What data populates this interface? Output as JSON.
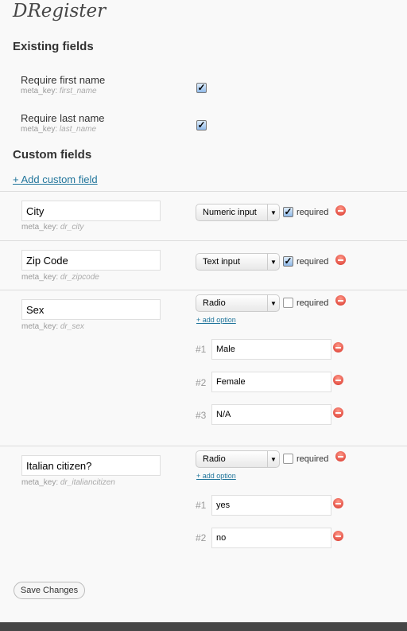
{
  "title": "DRegister",
  "existing": {
    "heading": "Existing fields",
    "items": [
      {
        "label": "Require first name",
        "meta_prefix": "meta_key:",
        "meta_key": "first_name",
        "checked": true
      },
      {
        "label": "Require last name",
        "meta_prefix": "meta_key:",
        "meta_key": "last_name",
        "checked": true
      }
    ]
  },
  "custom": {
    "heading": "Custom fields",
    "add_link": "+ Add custom field",
    "required_label": "required",
    "add_option": "+ add option",
    "meta_prefix": "meta_key:",
    "fields": [
      {
        "name": "City",
        "meta_key": "dr_city",
        "type": "Numeric input",
        "required": true
      },
      {
        "name": "Zip Code",
        "meta_key": "dr_zipcode",
        "type": "Text input",
        "required": true
      },
      {
        "name": "Sex",
        "meta_key": "dr_sex",
        "type": "Radio",
        "required": false,
        "options": [
          {
            "num": "#1",
            "value": "Male"
          },
          {
            "num": "#2",
            "value": "Female"
          },
          {
            "num": "#3",
            "value": "N/A"
          }
        ]
      },
      {
        "name": "Italian citizen?",
        "meta_key": "dr_italiancitizen",
        "type": "Radio",
        "required": false,
        "options": [
          {
            "num": "#1",
            "value": "yes"
          },
          {
            "num": "#2",
            "value": "no"
          }
        ]
      }
    ]
  },
  "save_label": "Save Changes"
}
